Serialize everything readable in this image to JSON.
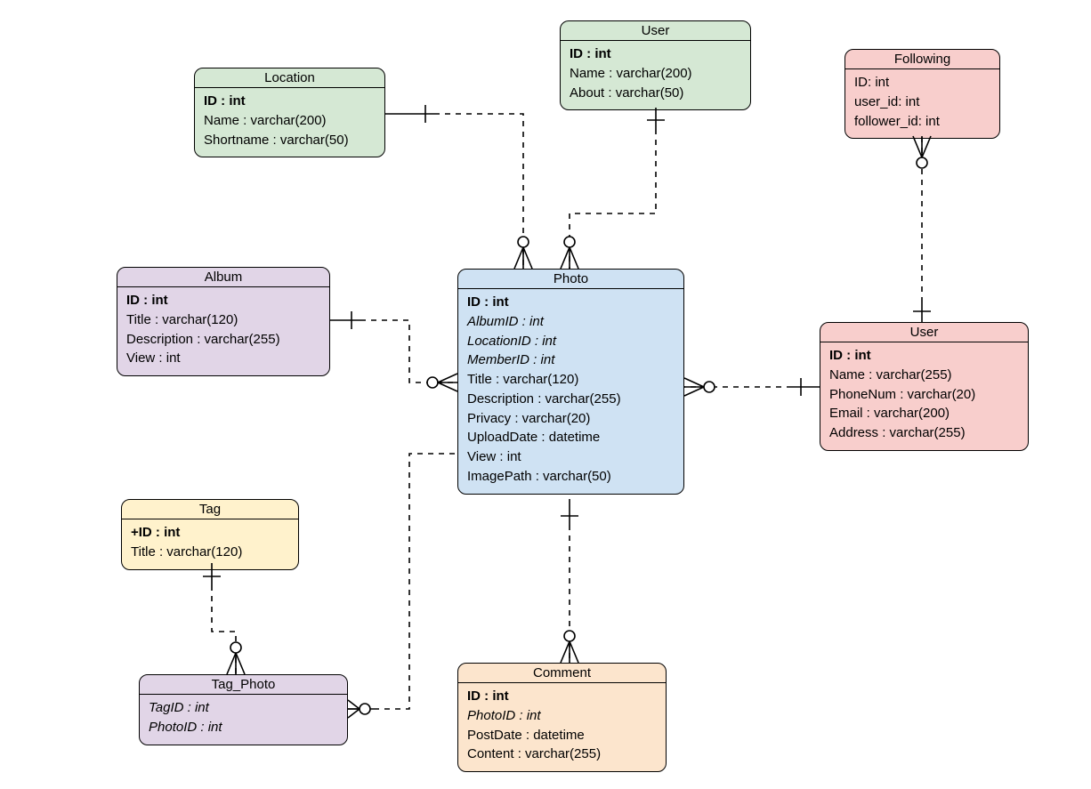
{
  "entities": {
    "location": {
      "title": "Location",
      "attrs": [
        {
          "text": "ID : int",
          "style": "bold"
        },
        {
          "text": "Name : varchar(200)"
        },
        {
          "text": "Shortname : varchar(50)"
        }
      ]
    },
    "userTop": {
      "title": "User",
      "attrs": [
        {
          "text": "ID : int",
          "style": "bold"
        },
        {
          "text": "Name : varchar(200)"
        },
        {
          "text": "About : varchar(50)"
        }
      ]
    },
    "following": {
      "title": "Following",
      "attrs": [
        {
          "text": "ID: int"
        },
        {
          "text": "user_id: int"
        },
        {
          "text": "follower_id: int"
        }
      ]
    },
    "album": {
      "title": "Album",
      "attrs": [
        {
          "text": "ID : int",
          "style": "bold"
        },
        {
          "text": "Title : varchar(120)"
        },
        {
          "text": "Description : varchar(255)"
        },
        {
          "text": "View : int"
        }
      ]
    },
    "photo": {
      "title": "Photo",
      "attrs": [
        {
          "text": "ID : int",
          "style": "bold"
        },
        {
          "text": "AlbumID : int",
          "style": "ital"
        },
        {
          "text": "LocationID : int",
          "style": "ital"
        },
        {
          "text": "MemberID : int",
          "style": "ital"
        },
        {
          "text": "Title : varchar(120)"
        },
        {
          "text": "Description : varchar(255)"
        },
        {
          "text": "Privacy : varchar(20)"
        },
        {
          "text": "UploadDate : datetime"
        },
        {
          "text": "View : int"
        },
        {
          "text": "ImagePath : varchar(50)"
        }
      ]
    },
    "userRight": {
      "title": "User",
      "attrs": [
        {
          "text": "ID : int",
          "style": "bold"
        },
        {
          "text": "Name : varchar(255)"
        },
        {
          "text": "PhoneNum : varchar(20)"
        },
        {
          "text": "Email : varchar(200)"
        },
        {
          "text": "Address : varchar(255)"
        }
      ]
    },
    "tag": {
      "title": "Tag",
      "attrs": [
        {
          "text": "+ID : int",
          "style": "bold"
        },
        {
          "text": "Title : varchar(120)"
        }
      ]
    },
    "tagPhoto": {
      "title": "Tag_Photo",
      "attrs": [
        {
          "text": "TagID : int",
          "style": "ital"
        },
        {
          "text": "PhotoID : int",
          "style": "ital"
        }
      ]
    },
    "comment": {
      "title": "Comment",
      "attrs": [
        {
          "text": "ID : int",
          "style": "bold"
        },
        {
          "text": "PhotoID : int",
          "style": "ital"
        },
        {
          "text": "PostDate : datetime"
        },
        {
          "text": "Content : varchar(255)"
        }
      ]
    }
  },
  "relationships": [
    {
      "from": "Location",
      "to": "Photo",
      "type": "one-to-many"
    },
    {
      "from": "User (top)",
      "to": "Photo",
      "type": "one-to-many"
    },
    {
      "from": "Album",
      "to": "Photo",
      "type": "one-to-many"
    },
    {
      "from": "User (right)",
      "to": "Photo",
      "type": "one-to-many"
    },
    {
      "from": "Photo",
      "to": "Comment",
      "type": "one-to-many"
    },
    {
      "from": "Tag",
      "to": "Tag_Photo",
      "type": "one-to-many"
    },
    {
      "from": "Tag_Photo",
      "to": "Photo",
      "type": "many-to-one"
    },
    {
      "from": "User (right)",
      "to": "Following",
      "type": "one-to-many"
    }
  ]
}
